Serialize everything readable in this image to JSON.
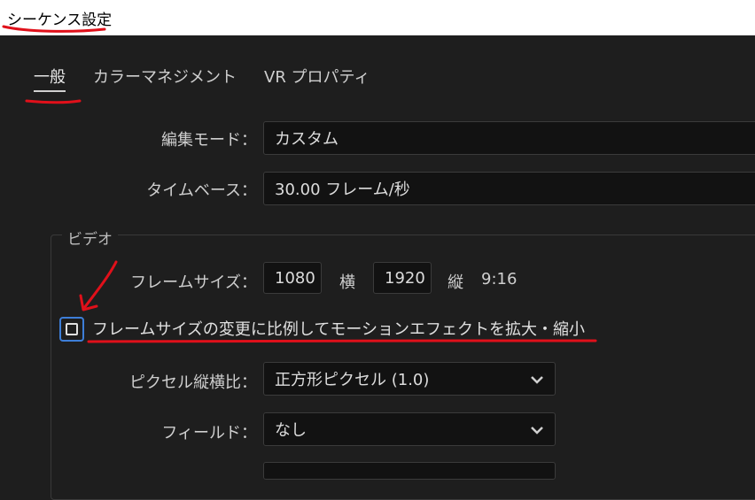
{
  "window": {
    "title": "シーケンス設定"
  },
  "tabs": [
    {
      "label": "一般",
      "active": true
    },
    {
      "label": "カラーマネジメント",
      "active": false
    },
    {
      "label": "VR プロパティ",
      "active": false
    }
  ],
  "general": {
    "edit_mode_label": "編集モード：",
    "edit_mode_value": "カスタム",
    "timebase_label": "タイムベース：",
    "timebase_value": "30.00  フレーム/秒"
  },
  "video": {
    "group_label": "ビデオ",
    "frame_size_label": "フレームサイズ：",
    "width_value": "1080",
    "width_unit": "横",
    "height_value": "1920",
    "height_unit": "縦",
    "aspect": "9:16",
    "scale_checkbox_label": "フレームサイズの変更に比例してモーションエフェクトを拡大・縮小",
    "scale_checkbox_checked": false,
    "pixel_aspect_label": "ピクセル縦横比：",
    "pixel_aspect_value": "正方形ピクセル (1.0)",
    "fields_label": "フィールド：",
    "fields_value": "なし"
  },
  "colors": {
    "accent_blue": "#3d7ed8",
    "annotation_red": "#e0101a"
  }
}
